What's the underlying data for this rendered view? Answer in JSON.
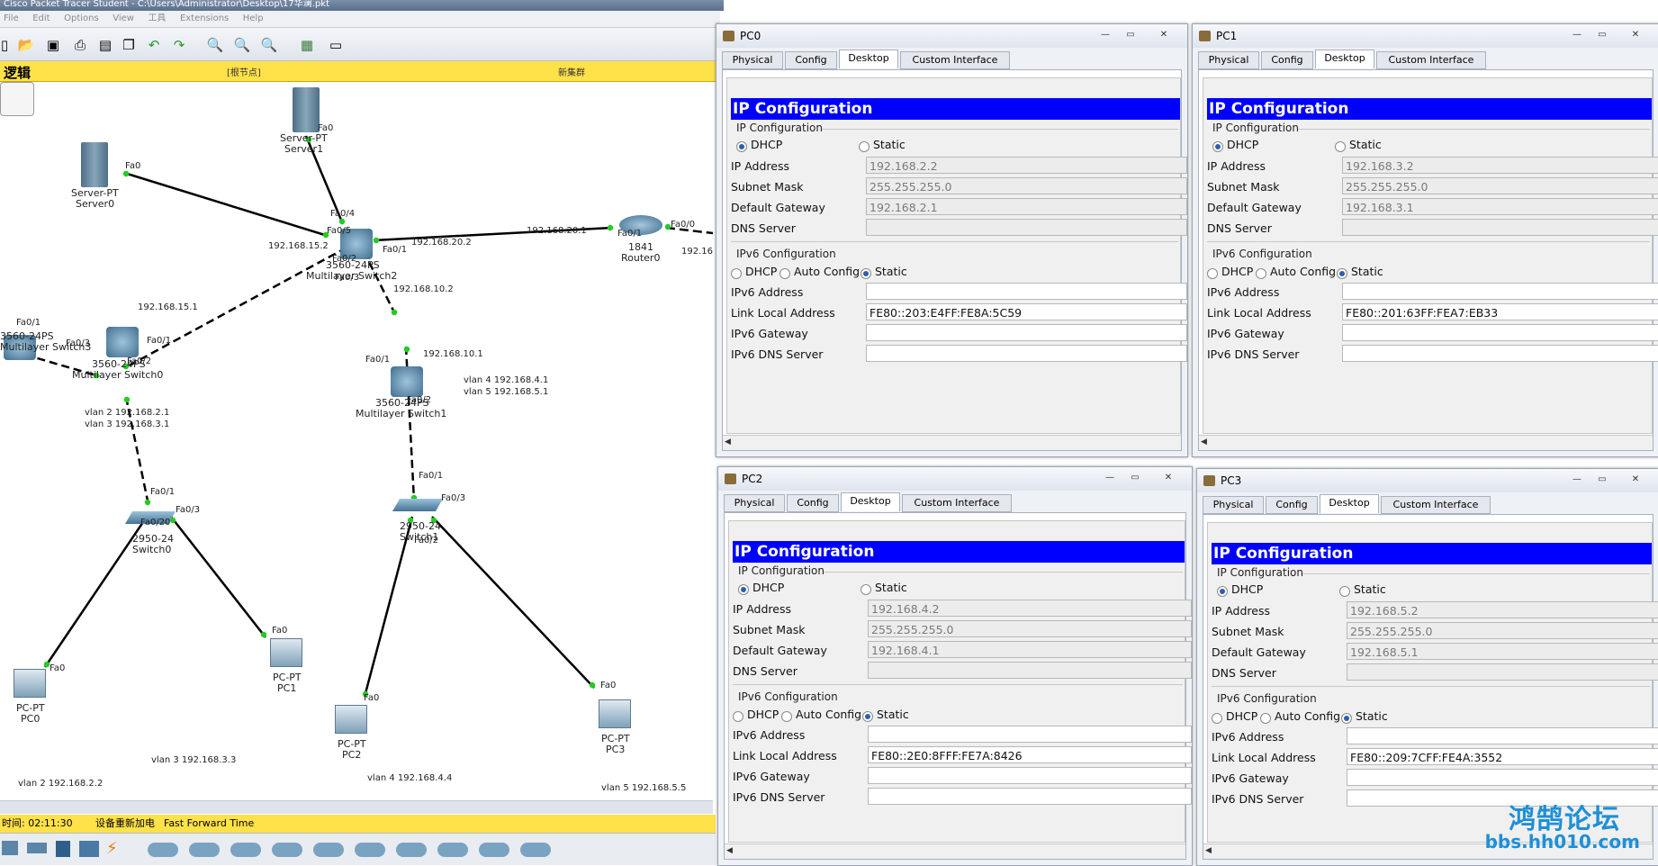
{
  "app": {
    "title": "Cisco Packet Tracer Student - C:\\Users\\Administrator\\Desktop\\17华澜.pkt",
    "menu": [
      "File",
      "Edit",
      "Options",
      "View",
      "工具",
      "Extensions",
      "Help"
    ],
    "logic_label": "逻辑",
    "nav_root": "[根节点]",
    "nav_new_cluster": "新集群",
    "status_time": "时间: 02:11:30",
    "status_power": "设备重新加电",
    "status_ff": "Fast Forward Time"
  },
  "topology": {
    "devices": [
      {
        "name": "Server-PT",
        "label": "Server1"
      },
      {
        "name": "Server-PT",
        "label": "Server0"
      },
      {
        "name": "3560-24PS",
        "label": "Multilayer Switch2"
      },
      {
        "name": "1841",
        "label": "Router0"
      },
      {
        "name": "3560-24PS",
        "label": "Multilayer Switch3"
      },
      {
        "name": "3560-24PS",
        "label": "Multilayer Switch0"
      },
      {
        "name": "3560-24PS",
        "label": "Multilayer Switch1"
      },
      {
        "name": "2950-24",
        "label": "Switch0"
      },
      {
        "name": "2950-24",
        "label": "Switch1"
      },
      {
        "name": "PC-PT",
        "label": "PC0"
      },
      {
        "name": "PC-PT",
        "label": "PC1"
      },
      {
        "name": "PC-PT",
        "label": "PC2"
      },
      {
        "name": "PC-PT",
        "label": "PC3"
      }
    ],
    "annotations": {
      "ip_15_2": "192.168.15.2",
      "ip_20_2": "192.168.20.2",
      "ip_20_1": "192.168.20.1",
      "ip_16": "192.16",
      "ip_15_1": "192.168.15.1",
      "ip_10_2": "192.168.10.2",
      "ip_10_1": "192.168.10.1",
      "vlan4": "vlan  4   192.168.4.1",
      "vlan5": "vlan  5   192.168.5.1",
      "vlan2": "vlan  2  192.168.2.1",
      "vlan3": "vlan 3  192.168.3.1",
      "pc0_note": "vlan 2  192.168.2.2",
      "pc1_note": "vlan 3  192.168.3.3",
      "pc2_note": "vlan 4  192.168.4.4",
      "pc3_note": "vlan  5  192.168.5.5"
    },
    "ports": [
      "Fa0",
      "Fa0/4",
      "Fa0/5",
      "Fa0/1",
      "Fa0/2",
      "Fa0/3",
      "Fa0/0",
      "Fa0/20"
    ]
  },
  "pc_windows": [
    {
      "title": "PC0",
      "tabs": [
        "Physical",
        "Config",
        "Desktop",
        "Custom Interface"
      ],
      "active_tab": "Desktop",
      "banner": "IP Configuration",
      "ipv4_heading": "IP Configuration",
      "mode_dhcp": "DHCP",
      "mode_static": "Static",
      "ip_label": "IP Address",
      "ip": "192.168.2.2",
      "mask_label": "Subnet Mask",
      "mask": "255.255.255.0",
      "gw_label": "Default Gateway",
      "gw": "192.168.2.1",
      "dns_label": "DNS Server",
      "dns": "",
      "ipv6_heading": "IPv6 Configuration",
      "v6_dhcp": "DHCP",
      "v6_auto": "Auto Config",
      "v6_static": "Static",
      "ipv6_label": "IPv6 Address",
      "ipv6": "",
      "lla_label": "Link Local Address",
      "lla": "FE80::203:E4FF:FE8A:5C59",
      "v6gw_label": "IPv6 Gateway",
      "v6gw": "",
      "v6dns_label": "IPv6 DNS Server",
      "v6dns": ""
    },
    {
      "title": "PC1",
      "tabs": [
        "Physical",
        "Config",
        "Desktop",
        "Custom Interface"
      ],
      "active_tab": "Desktop",
      "banner": "IP Configuration",
      "ipv4_heading": "IP Configuration",
      "mode_dhcp": "DHCP",
      "mode_static": "Static",
      "ip_label": "IP Address",
      "ip": "192.168.3.2",
      "mask_label": "Subnet Mask",
      "mask": "255.255.255.0",
      "gw_label": "Default Gateway",
      "gw": "192.168.3.1",
      "dns_label": "DNS Server",
      "dns": "",
      "ipv6_heading": "IPv6 Configuration",
      "v6_dhcp": "DHCP",
      "v6_auto": "Auto Config",
      "v6_static": "Static",
      "ipv6_label": "IPv6 Address",
      "ipv6": "",
      "lla_label": "Link Local Address",
      "lla": "FE80::201:63FF:FEA7:EB33",
      "v6gw_label": "IPv6 Gateway",
      "v6gw": "",
      "v6dns_label": "IPv6 DNS Server",
      "v6dns": ""
    },
    {
      "title": "PC2",
      "tabs": [
        "Physical",
        "Config",
        "Desktop",
        "Custom Interface"
      ],
      "active_tab": "Desktop",
      "banner": "IP Configuration",
      "ipv4_heading": "IP Configuration",
      "mode_dhcp": "DHCP",
      "mode_static": "Static",
      "ip_label": "IP Address",
      "ip": "192.168.4.2",
      "mask_label": "Subnet Mask",
      "mask": "255.255.255.0",
      "gw_label": "Default Gateway",
      "gw": "192.168.4.1",
      "dns_label": "DNS Server",
      "dns": "",
      "ipv6_heading": "IPv6 Configuration",
      "v6_dhcp": "DHCP",
      "v6_auto": "Auto Config",
      "v6_static": "Static",
      "ipv6_label": "IPv6 Address",
      "ipv6": "",
      "lla_label": "Link Local Address",
      "lla": "FE80::2E0:8FFF:FE7A:8426",
      "v6gw_label": "IPv6 Gateway",
      "v6gw": "",
      "v6dns_label": "IPv6 DNS Server",
      "v6dns": ""
    },
    {
      "title": "PC3",
      "tabs": [
        "Physical",
        "Config",
        "Desktop",
        "Custom Interface"
      ],
      "active_tab": "Desktop",
      "banner": "IP Configuration",
      "ipv4_heading": "IP Configuration",
      "mode_dhcp": "DHCP",
      "mode_static": "Static",
      "ip_label": "IP Address",
      "ip": "192.168.5.2",
      "mask_label": "Subnet Mask",
      "mask": "255.255.255.0",
      "gw_label": "Default Gateway",
      "gw": "192.168.5.1",
      "dns_label": "DNS Server",
      "dns": "",
      "ipv6_heading": "IPv6 Configuration",
      "v6_dhcp": "DHCP",
      "v6_auto": "Auto Config",
      "v6_static": "Static",
      "ipv6_label": "IPv6 Address",
      "ipv6": "",
      "lla_label": "Link Local Address",
      "lla": "FE80::209:7CFF:FE4A:3552",
      "v6gw_label": "IPv6 Gateway",
      "v6gw": "",
      "v6dns_label": "IPv6 DNS Server",
      "v6dns": ""
    }
  ],
  "watermark": {
    "cn": "鸿鹄论坛",
    "url": "bbs.hh010.com"
  },
  "colors": {
    "banner_blue": "#0000ff",
    "logic_yellow": "#ffe14a",
    "link_green": "#22cc22"
  }
}
